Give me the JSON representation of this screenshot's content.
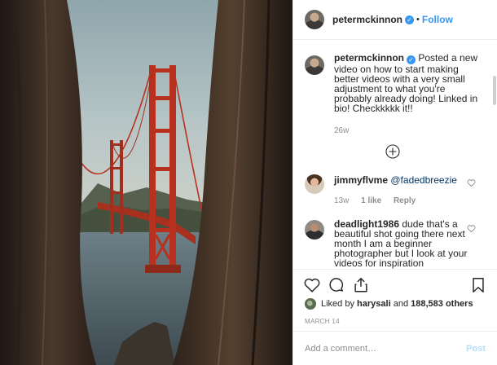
{
  "header": {
    "username": "petermckinnon",
    "separator": "•",
    "follow_label": "Follow"
  },
  "caption": {
    "username": "petermckinnon",
    "text": "Posted a new video on how to start making better videos with a very small adjustment to what you're probably already doing! Linked in bio! Checkkkkk it!!",
    "age": "26w"
  },
  "comments": [
    {
      "username": "jimmyflvme",
      "text": "@fadedbreezie",
      "age": "13w",
      "likes": "1 like",
      "reply_label": "Reply"
    },
    {
      "username": "deadlight1986",
      "text": "dude that's a beautiful shot going there next month I am a beginner photographer but I look at your videos for inspiration",
      "age": "",
      "likes": "",
      "reply_label": ""
    }
  ],
  "likes": {
    "prefix": "Liked by",
    "user": "harysali",
    "conjunction": "and",
    "count": "188,583 others"
  },
  "date": "MARCH 14",
  "add_comment": {
    "placeholder": "Add a comment…",
    "post_label": "Post"
  },
  "icons": {
    "verified": "verified-badge",
    "load_more": "plus-circle-icon",
    "like": "heart-icon",
    "comment": "speech-bubble-icon",
    "share": "share-icon",
    "save": "bookmark-icon"
  },
  "colors": {
    "accent": "#3897f0",
    "muted": "#8e8e8e",
    "post_disabled": "#b2dffc",
    "bridge": "#b8311f"
  }
}
